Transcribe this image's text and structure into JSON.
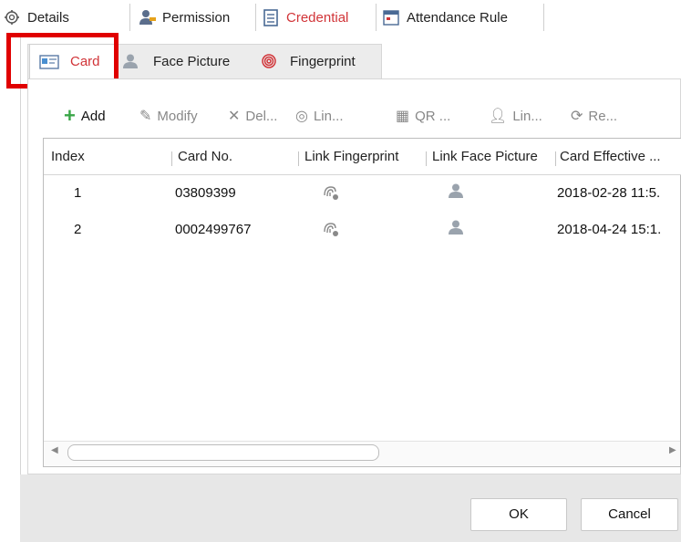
{
  "top_tabs": [
    {
      "label": "Details",
      "icon": "gear-icon"
    },
    {
      "label": "Permission",
      "icon": "user-key-icon"
    },
    {
      "label": "Credential",
      "icon": "credential-icon",
      "active": true
    },
    {
      "label": "Attendance Rule",
      "icon": "calendar-icon"
    }
  ],
  "sub_tabs": [
    {
      "label": "Card",
      "icon": "card-icon",
      "active": true
    },
    {
      "label": "Face Picture",
      "icon": "face-icon"
    },
    {
      "label": "Fingerprint",
      "icon": "fingerprint-icon"
    }
  ],
  "toolbar": {
    "add": "Add",
    "modify": "Modify",
    "delete": "Del...",
    "link": "Lin...",
    "qr": "QR ...",
    "link_person": "Lin...",
    "read": "Re..."
  },
  "table": {
    "columns": [
      "Index",
      "Card No.",
      "Link Fingerprint",
      "Link Face Picture",
      "Card Effective ..."
    ],
    "rows": [
      {
        "index": "1",
        "card_no": "03809399",
        "effective": "2018-02-28 11:5."
      },
      {
        "index": "2",
        "card_no": "0002499767",
        "effective": "2018-04-24 15:1."
      }
    ]
  },
  "footer": {
    "ok": "OK",
    "cancel": "Cancel"
  },
  "colors": {
    "active_tab": "#d13438",
    "highlight_box": "#e00000",
    "add_icon": "#3aa648"
  }
}
